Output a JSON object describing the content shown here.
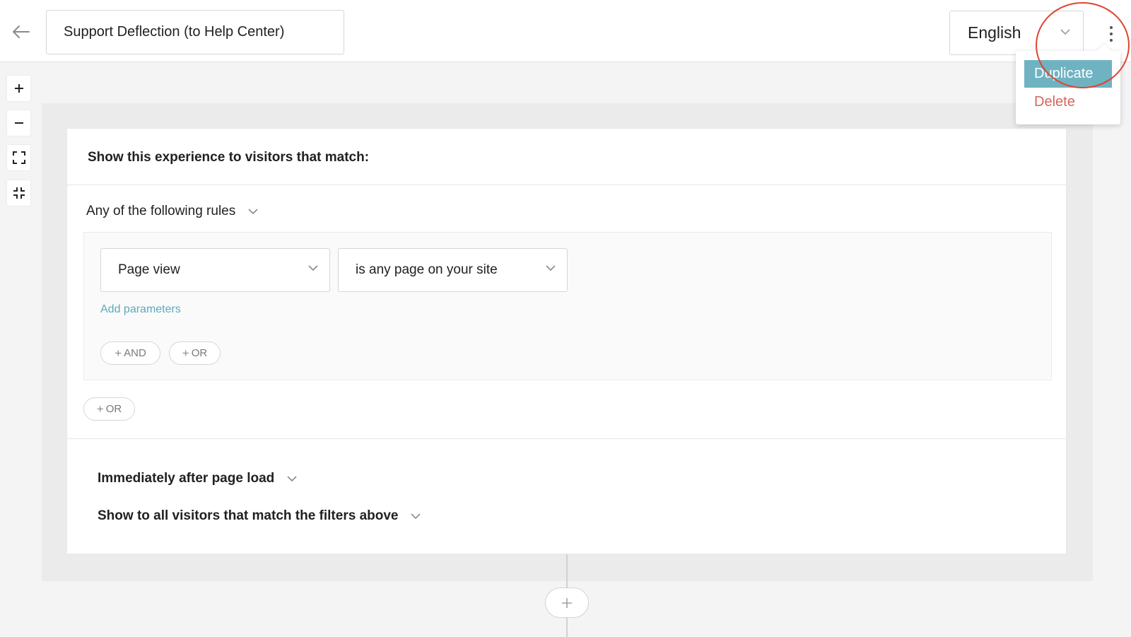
{
  "header": {
    "experience_name": "Support Deflection (to Help Center)",
    "language": "English"
  },
  "menu": {
    "items": [
      {
        "label": "Duplicate",
        "highlighted": true
      },
      {
        "label": "Delete",
        "color": "#d6665a"
      }
    ]
  },
  "zoom_controls": [
    "zoom-in",
    "zoom-out",
    "fit-to-screen",
    "collapse"
  ],
  "card": {
    "title": "Show this experience to visitors that match:",
    "rules_mode": "Any of the following rules",
    "rule": {
      "event": "Page view",
      "condition": "is any page on your site",
      "add_parameters": "Add parameters",
      "and_label": "AND",
      "or_label": "OR"
    },
    "or_label": "OR",
    "timing": "Immediately after page load",
    "audience": "Show to all visitors that match the filters above"
  },
  "colors": {
    "accent": "#6fb3c2",
    "link": "#5aaabd",
    "danger": "#d6665a",
    "annotation": "#e0442f"
  }
}
